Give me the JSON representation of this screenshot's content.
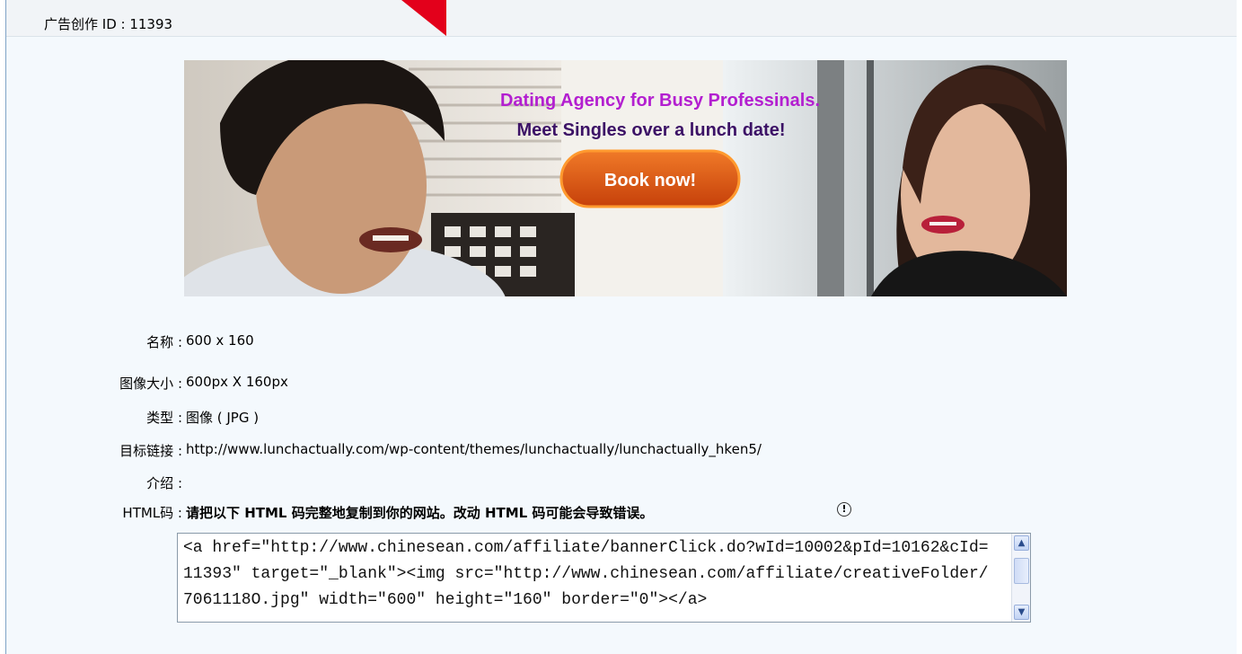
{
  "header": {
    "title": "广告创作 ID : 11393"
  },
  "banner": {
    "headline": "Dating Agency for Busy Professinals.",
    "subline": "Meet Singles over a lunch date!",
    "button_label": "Book now!",
    "colors": {
      "headline": "#b31fd0",
      "subline": "#3c1266",
      "button": "#e0510f"
    }
  },
  "details": {
    "name_label": "名称 :",
    "name_value": "600 x 160",
    "size_label": "图像大小 :",
    "size_value": "600px X 160px",
    "type_label": "类型 :",
    "type_value": "图像 ( JPG )",
    "url_label": "目标链接 :",
    "url_value": "http://www.lunchactually.com/wp-content/themes/lunchactually/lunchactually_hken5/",
    "intro_label": "介绍 :",
    "intro_value": "",
    "html_label": "HTML码 :",
    "html_note": "请把以下 HTML 码完整地复制到你的网站。改动 HTML 码可能会导致错误。",
    "info_icon": "info-icon"
  },
  "code": {
    "value": "<a href=\"http://www.chinesean.com/affiliate/bannerClick.do?wId=10002&pId=10162&cId=11393\" target=\"_blank\"><img src=\"http://www.chinesean.com/affiliate/creativeFolder/7061118O.jpg\" width=\"600\" height=\"160\" border=\"0\"></a>"
  }
}
